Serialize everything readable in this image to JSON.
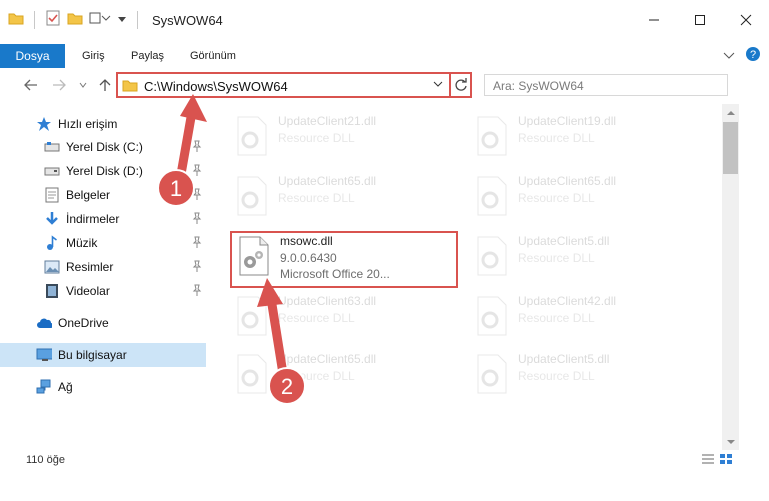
{
  "window": {
    "title": "SysWOW64"
  },
  "ribbon": {
    "tabs": [
      {
        "label": "Dosya"
      },
      {
        "label": "Giriş"
      },
      {
        "label": "Paylaş"
      },
      {
        "label": "Görünüm"
      }
    ]
  },
  "navbar": {
    "address": "C:\\Windows\\SysWOW64",
    "search_placeholder": "Ara: SysWOW64"
  },
  "sidebar": {
    "items": [
      {
        "label": "Hızlı erişim",
        "icon": "star-icon"
      },
      {
        "label": "Yerel Disk (C:)",
        "icon": "drive-icon",
        "pinned": true
      },
      {
        "label": "Yerel Disk (D:)",
        "icon": "drive-icon",
        "pinned": true
      },
      {
        "label": "Belgeler",
        "icon": "documents-icon",
        "pinned": true
      },
      {
        "label": "İndirmeler",
        "icon": "download-icon",
        "pinned": true
      },
      {
        "label": "Müzik",
        "icon": "music-icon",
        "pinned": true
      },
      {
        "label": "Resimler",
        "icon": "pictures-icon",
        "pinned": true
      },
      {
        "label": "Videolar",
        "icon": "videos-icon",
        "pinned": true
      },
      {
        "label": "OneDrive",
        "icon": "cloud-icon"
      },
      {
        "label": "Bu bilgisayar",
        "icon": "computer-icon",
        "selected": true
      },
      {
        "label": "Ağ",
        "icon": "network-icon"
      }
    ]
  },
  "files": {
    "left": [
      {
        "name": "UpdateClient21.dll",
        "sub": "Resource DLL"
      },
      {
        "name": "UpdateClient65.dll",
        "sub": "Resource DLL"
      },
      {
        "name": "msowc.dll",
        "sub": "9.0.0.6430",
        "sub2": "Microsoft Office 20...",
        "highlighted": true
      },
      {
        "name": "UpdateClient63.dll",
        "sub": "Resource DLL"
      },
      {
        "name": "UpdateClient65.dll",
        "sub": "Resource DLL"
      }
    ],
    "right": [
      {
        "name": "UpdateClient19.dll",
        "sub": "Resource DLL"
      },
      {
        "name": "UpdateClient65.dll",
        "sub": "Resource DLL"
      },
      {
        "name": "UpdateClient5.dll",
        "sub": "Resource DLL"
      },
      {
        "name": "UpdateClient42.dll",
        "sub": "Resource DLL"
      },
      {
        "name": "UpdateClient5.dll",
        "sub": "Resource DLL"
      }
    ]
  },
  "status": {
    "count": "110 öğe"
  },
  "annotations": {
    "step1": "1",
    "step2": "2",
    "accent": "#d9534f"
  }
}
